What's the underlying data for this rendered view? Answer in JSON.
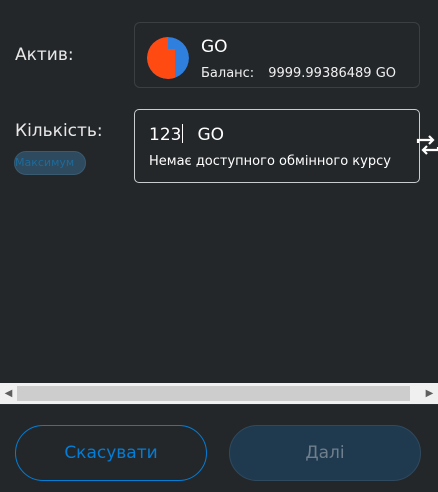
{
  "labels": {
    "asset": "Актив:",
    "amount": "Кількість:"
  },
  "asset": {
    "symbol": "GO",
    "balance_label": "Баланс:",
    "balance_value": "9999.99386489 GO",
    "logo_icon": "go-token-logo",
    "logo_colors": {
      "primary": "#ff4a12",
      "secondary": "#2f7fdf"
    }
  },
  "amount": {
    "value": "123",
    "unit": "GO",
    "error": "Немає доступного обмінного курсу"
  },
  "max_button": {
    "label": "Максимум"
  },
  "swap_icon": "swap-arrows-icon",
  "footer": {
    "cancel_label": "Скасувати",
    "next_label": "Далі"
  },
  "colors": {
    "background": "#24272a",
    "accent": "#037dd6",
    "disabled_button": "#1f3a4f"
  }
}
